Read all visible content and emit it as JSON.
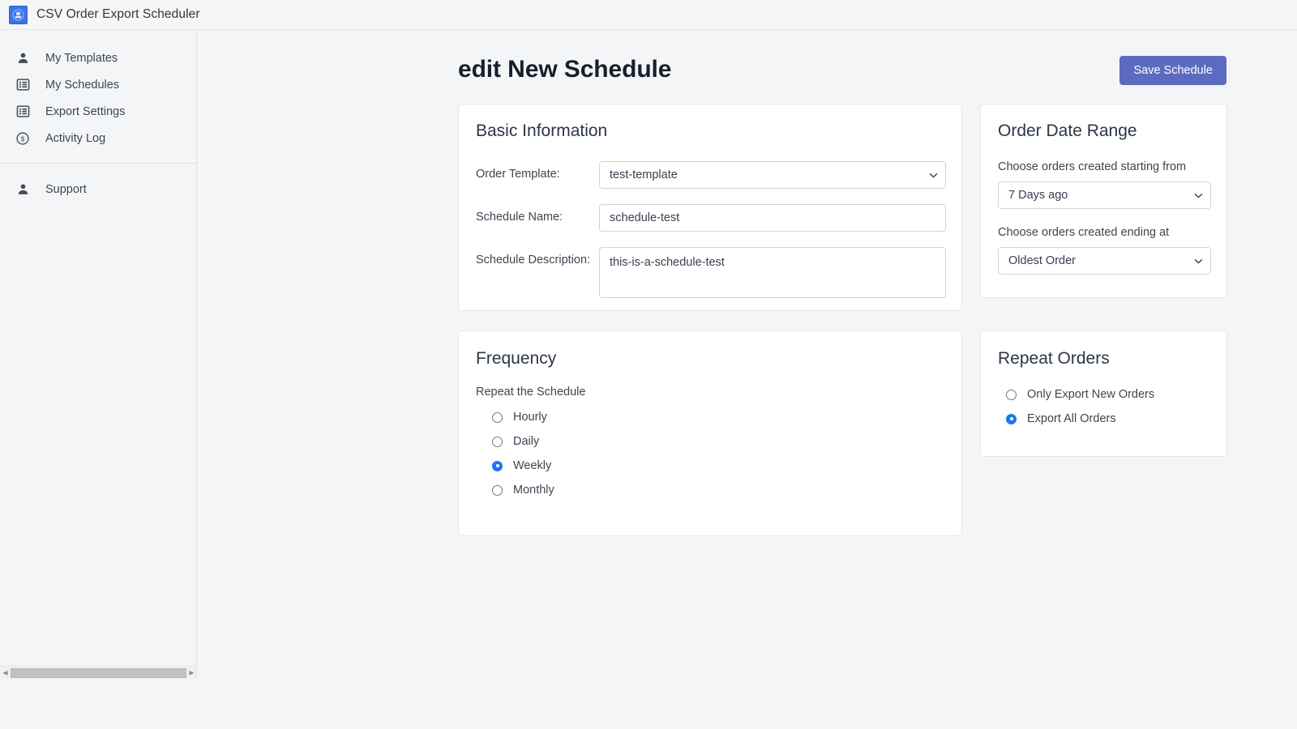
{
  "app": {
    "title": "CSV Order Export Scheduler",
    "logo_icon": "export-app-icon"
  },
  "sidebar": {
    "primary_items": [
      {
        "label": "My Templates",
        "icon": "person-icon"
      },
      {
        "label": "My Schedules",
        "icon": "list-icon"
      },
      {
        "label": "Export Settings",
        "icon": "list-icon"
      },
      {
        "label": "Activity Log",
        "icon": "dollar-circle-icon"
      }
    ],
    "secondary_items": [
      {
        "label": "Support",
        "icon": "person-icon"
      }
    ],
    "scrollbar": {
      "left_arrow": "◀",
      "right_arrow": "▶"
    }
  },
  "header": {
    "title": "edit New Schedule",
    "save_button": "Save Schedule"
  },
  "basic_information": {
    "title": "Basic Information",
    "fields": {
      "order_template": {
        "label": "Order Template:",
        "value": "test-template",
        "options": [
          "test-template"
        ]
      },
      "schedule_name": {
        "label": "Schedule Name:",
        "value": "schedule-test",
        "placeholder": ""
      },
      "schedule_description": {
        "label": "Schedule Description:",
        "value": "this-is-a-schedule-test",
        "placeholder": ""
      }
    }
  },
  "order_date_range": {
    "title": "Order Date Range",
    "from_label": "Choose orders created starting from",
    "from_value": "7 Days ago",
    "from_options": [
      "7 Days ago"
    ],
    "to_label": "Choose orders created ending at",
    "to_value": "Oldest Order",
    "to_options": [
      "Oldest Order"
    ]
  },
  "frequency": {
    "title": "Frequency",
    "sublabel": "Repeat the Schedule",
    "options": [
      {
        "label": "Hourly",
        "selected": false
      },
      {
        "label": "Daily",
        "selected": false
      },
      {
        "label": "Weekly",
        "selected": true
      },
      {
        "label": "Monthly",
        "selected": false
      }
    ]
  },
  "repeat_orders": {
    "title": "Repeat Orders",
    "options": [
      {
        "label": "Only Export New Orders",
        "selected": false
      },
      {
        "label": "Export All Orders",
        "selected": true
      }
    ]
  },
  "colors": {
    "accent_blue": "#3b74e8",
    "save_button": "#5c6bc0",
    "radio_selected": "#1977f2",
    "page_background": "#f4f5f7",
    "card_background": "#ffffff"
  }
}
